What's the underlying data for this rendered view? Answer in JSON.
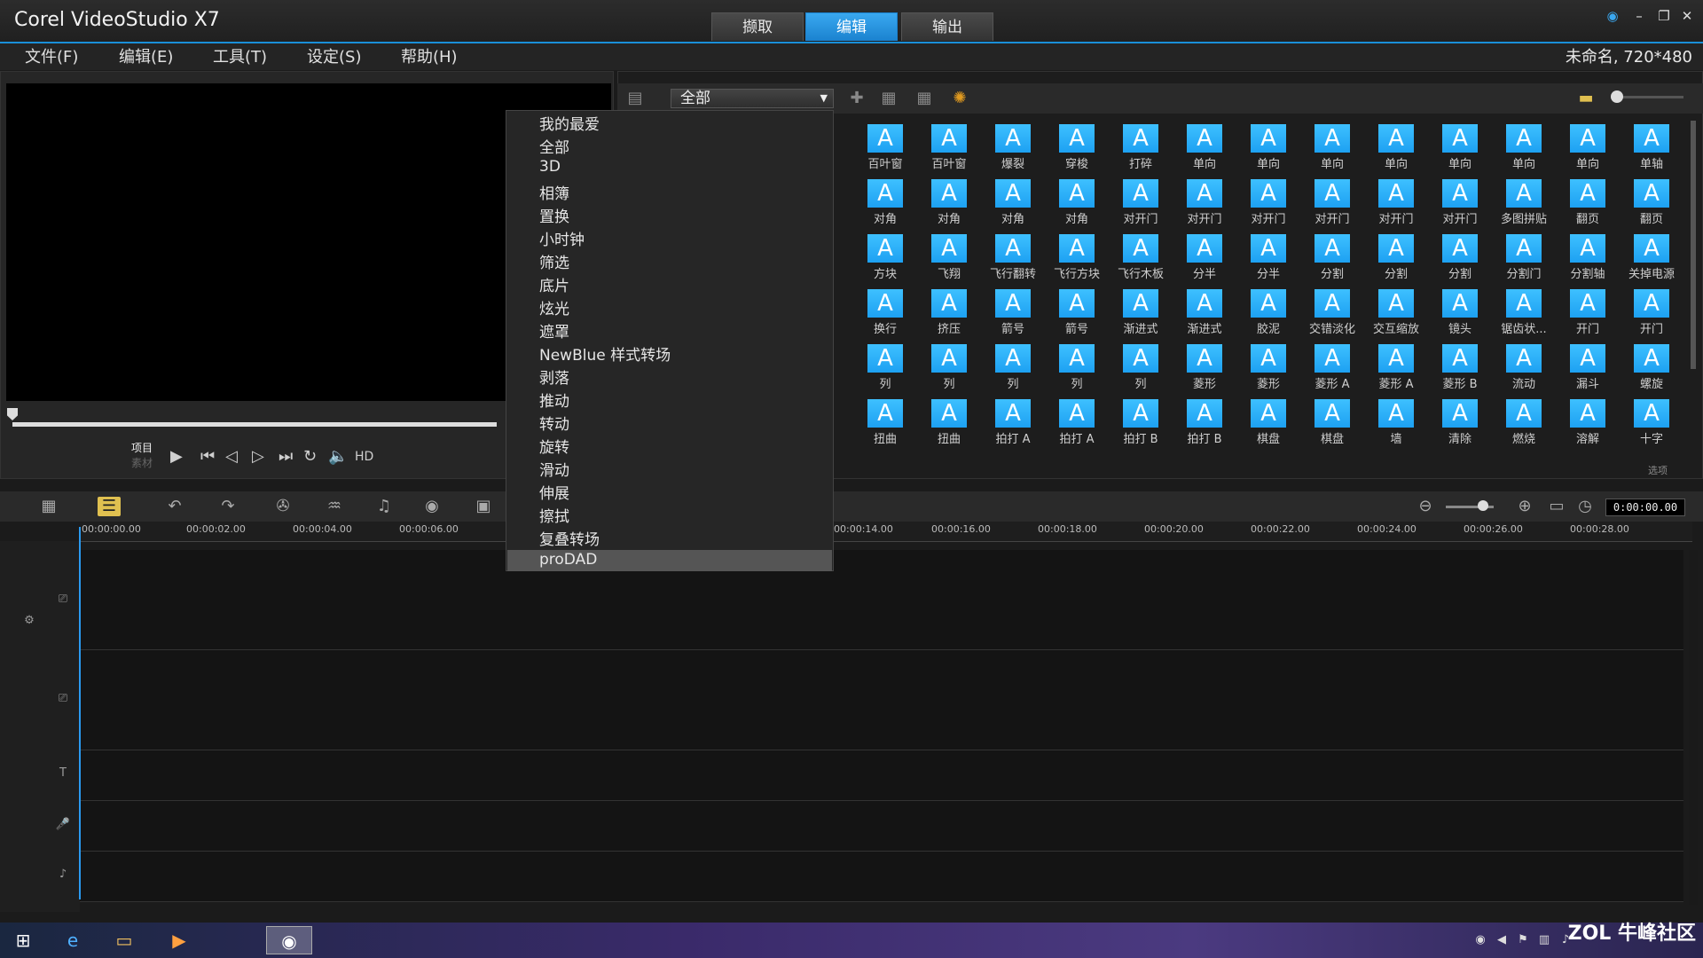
{
  "titlebar": {
    "app_title": "Corel VideoStudio X7",
    "tabs": [
      "撷取",
      "编辑",
      "输出"
    ],
    "active_tab": "编辑"
  },
  "menubar": {
    "items": [
      "文件(F)",
      "编辑(E)",
      "工具(T)",
      "设定(S)",
      "帮助(H)"
    ],
    "project_info": "未命名, 720*480"
  },
  "player": {
    "project_label": "项目",
    "clip_label": "素材",
    "hd_label": "HD"
  },
  "library": {
    "category_selected": "全部",
    "options_label": "选项",
    "thumbnail_glyph": "A",
    "items": [
      "百叶窗",
      "百叶窗",
      "爆裂",
      "穿梭",
      "打碎",
      "单向",
      "单向",
      "单向",
      "单向",
      "单向",
      "单向",
      "单向",
      "单轴",
      "对角",
      "对角",
      "对角",
      "对角",
      "对开门",
      "对开门",
      "对开门",
      "对开门",
      "对开门",
      "对开门",
      "多图拼贴",
      "翻页",
      "翻页",
      "方块",
      "飞翔",
      "飞行翻转",
      "飞行方块",
      "飞行木板",
      "分半",
      "分半",
      "分割",
      "分割",
      "分割",
      "分割门",
      "分割轴",
      "关掉电源",
      "换行",
      "挤压",
      "箭号",
      "箭号",
      "渐进式",
      "渐进式",
      "胶泥",
      "交错淡化",
      "交互缩放",
      "镜头",
      "锯齿状...",
      "开门",
      "开门",
      "列",
      "列",
      "列",
      "列",
      "列",
      "菱形",
      "菱形",
      "菱形 A",
      "菱形 A",
      "菱形 B",
      "流动",
      "漏斗",
      "螺旋",
      "扭曲",
      "扭曲",
      "拍打 A",
      "拍打 A",
      "拍打 B",
      "拍打 B",
      "棋盘",
      "棋盘",
      "墙",
      "清除",
      "燃烧",
      "溶解",
      "十字"
    ]
  },
  "dropdown": {
    "items": [
      "我的最爱",
      "全部",
      "3D",
      "相簿",
      "置换",
      "小时钟",
      "筛选",
      "底片",
      "炫光",
      "遮罩",
      "NewBlue 样式转场",
      "剥落",
      "推动",
      "转动",
      "旋转",
      "滑动",
      "伸展",
      "擦拭",
      "复叠转场",
      "proDAD"
    ],
    "selected": "proDAD"
  },
  "timeline": {
    "timecode": "0:00:00.00",
    "ruler_ticks": [
      "00:00:00.00",
      "00:00:02.00",
      "00:00:04.00",
      "00:00:06.00",
      "00:00:14.00",
      "00:00:16.00",
      "00:00:18.00",
      "00:00:20.00",
      "00:00:22.00",
      "00:00:24.00",
      "00:00:26.00",
      "00:00:28.00"
    ]
  },
  "taskbar": {
    "watermark": "ZOL 牛峰社区"
  },
  "colors": {
    "accent": "#1da1f2",
    "tile": "#26aaf5",
    "selected_item_bg": "#555555"
  }
}
